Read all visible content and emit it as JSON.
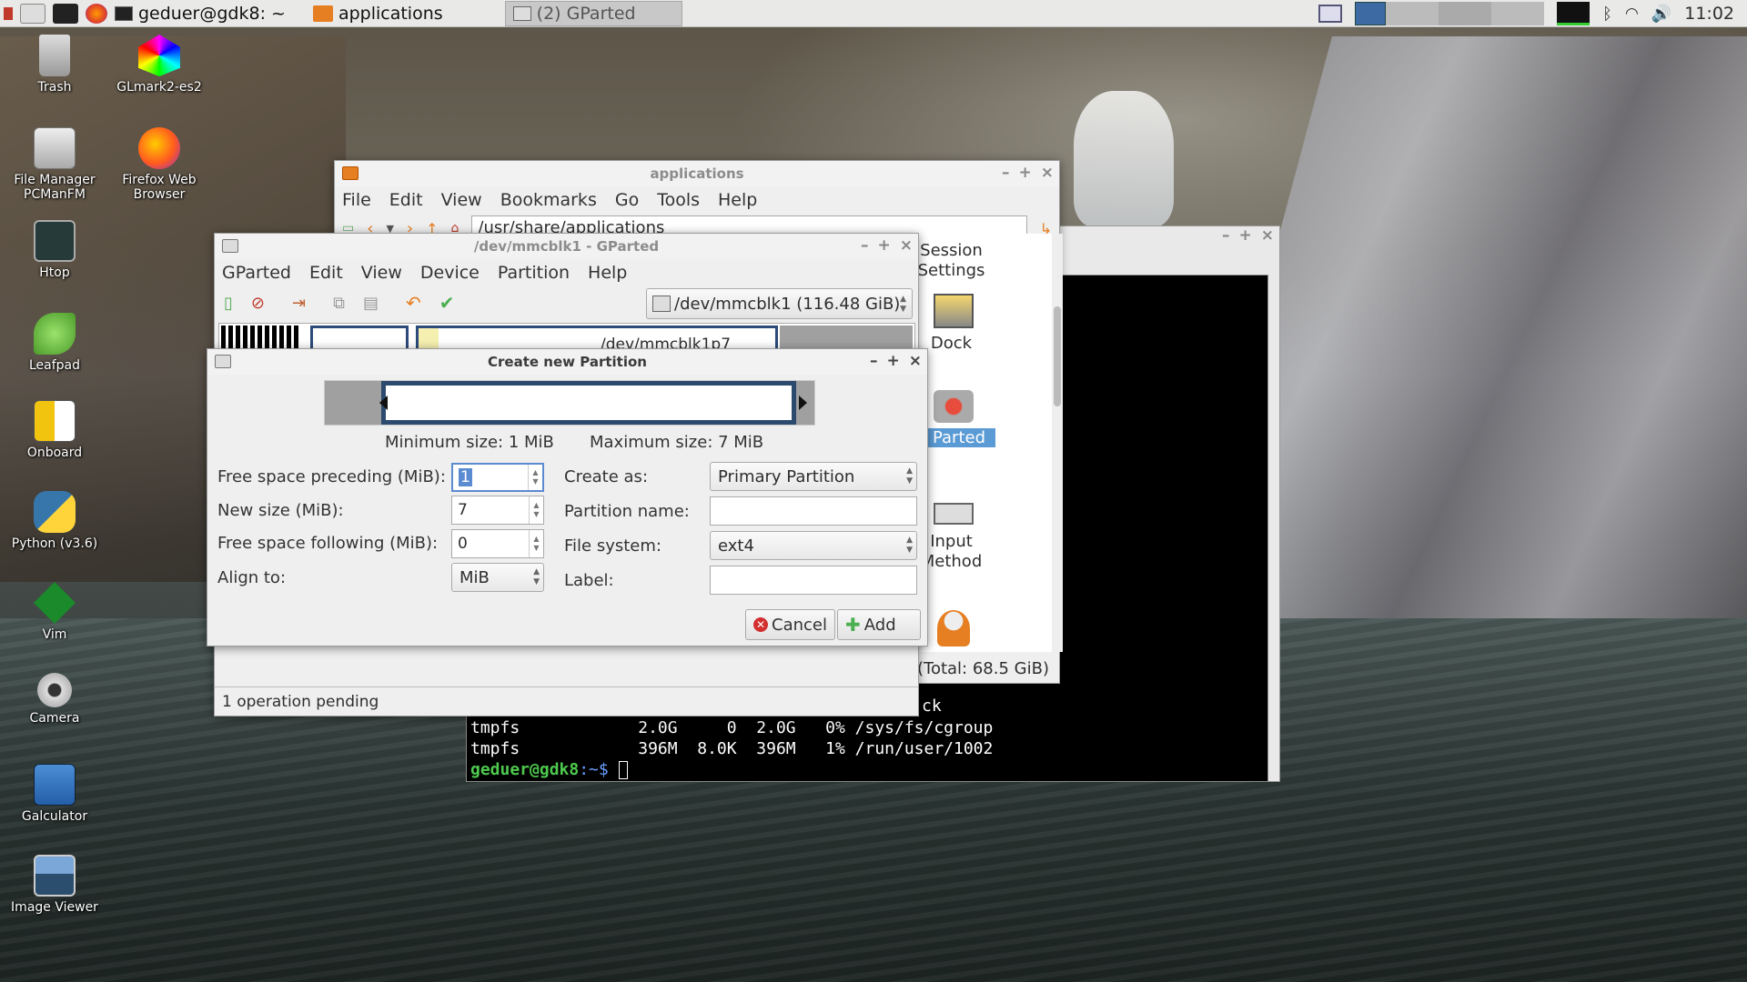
{
  "panel": {
    "tasks": [
      {
        "label": "geduer@gdk8: ~"
      },
      {
        "label": "applications"
      },
      {
        "label": "(2) GParted"
      }
    ],
    "clock": "11:02"
  },
  "desktop": {
    "icons": [
      {
        "label": "Trash"
      },
      {
        "label": "GLmark2-es2"
      },
      {
        "label": "File Manager PCManFM"
      },
      {
        "label": "Firefox Web Browser"
      },
      {
        "label": "Htop"
      },
      {
        "label": "Leafpad"
      },
      {
        "label": "Onboard"
      },
      {
        "label": "Python (v3.6)"
      },
      {
        "label": "Vim"
      },
      {
        "label": "Camera"
      },
      {
        "label": "Galculator"
      },
      {
        "label": "Image Viewer"
      }
    ]
  },
  "filemanager": {
    "title": "applications",
    "menu": [
      "File",
      "Edit",
      "View",
      "Bookmarks",
      "Go",
      "Tools",
      "Help"
    ],
    "path": "/usr/share/applications",
    "side_items": [
      "Session Settings",
      "Dock",
      "Parted",
      "Input Method"
    ],
    "status": "(Total: 68.5 GiB)"
  },
  "terminal": {
    "lines": [
      {
        "text": "tmpfs            2.0G     0  2.0G   0% /sys/fs/cgroup"
      },
      {
        "text": "tmpfs            396M  8.0K  396M   1% /run/user/1002"
      }
    ],
    "partial": "ck",
    "prompt_user": "geduer@gdk8",
    "prompt_rest": ":~$ "
  },
  "gparted": {
    "title": "/dev/mmcblk1 - GParted",
    "menu": [
      "GParted",
      "Edit",
      "View",
      "Device",
      "Partition",
      "Help"
    ],
    "device": "/dev/mmcblk1  (116.48 GiB)",
    "partition_label": "/dev/mmcblk1p7",
    "status": "1 operation pending"
  },
  "dialog": {
    "title": "Create new Partition",
    "min_size": "Minimum size: 1 MiB",
    "max_size": "Maximum size: 7 MiB",
    "labels": {
      "preceding": "Free space preceding (MiB):",
      "new_size": "New size (MiB):",
      "following": "Free space following (MiB):",
      "align": "Align to:",
      "create_as": "Create as:",
      "name": "Partition name:",
      "fs": "File system:",
      "label": "Label:"
    },
    "values": {
      "preceding": "1",
      "new_size": "7",
      "following": "0",
      "align": "MiB",
      "create_as": "Primary Partition",
      "name": "",
      "fs": "ext4",
      "label": ""
    },
    "cancel": "Cancel",
    "add": "Add"
  }
}
